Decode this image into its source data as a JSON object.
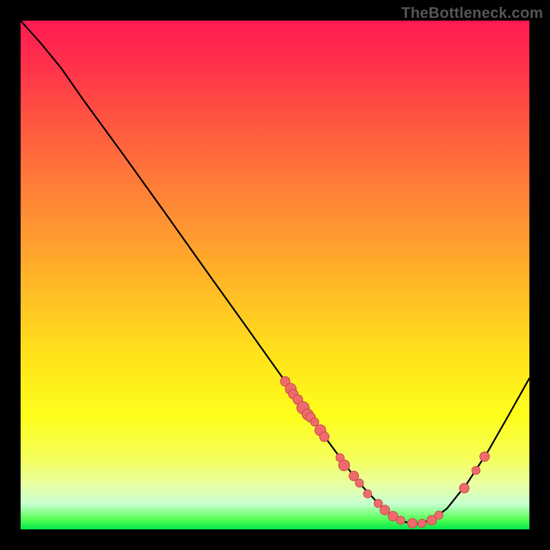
{
  "watermark": "TheBottleneck.com",
  "colors": {
    "point_fill": "#ef6b6b",
    "point_stroke": "#c24848",
    "curve": "#000000"
  },
  "chart_data": {
    "type": "line",
    "title": "",
    "xlabel": "",
    "ylabel": "",
    "xlim": [
      0,
      100
    ],
    "ylim": [
      0,
      100
    ],
    "grid": false,
    "curve": [
      {
        "x": 0.0,
        "y": 100.0
      },
      {
        "x": 4.1,
        "y": 95.4
      },
      {
        "x": 8.1,
        "y": 90.5
      },
      {
        "x": 12.2,
        "y": 84.6
      },
      {
        "x": 20.3,
        "y": 73.5
      },
      {
        "x": 28.4,
        "y": 62.2
      },
      {
        "x": 36.5,
        "y": 50.8
      },
      {
        "x": 44.6,
        "y": 39.5
      },
      {
        "x": 52.7,
        "y": 28.1
      },
      {
        "x": 58.1,
        "y": 20.5
      },
      {
        "x": 62.2,
        "y": 14.9
      },
      {
        "x": 66.2,
        "y": 9.5
      },
      {
        "x": 70.3,
        "y": 5.1
      },
      {
        "x": 73.0,
        "y": 2.7
      },
      {
        "x": 75.7,
        "y": 1.4
      },
      {
        "x": 78.4,
        "y": 1.1
      },
      {
        "x": 81.1,
        "y": 2.0
      },
      {
        "x": 83.8,
        "y": 4.1
      },
      {
        "x": 87.8,
        "y": 9.1
      },
      {
        "x": 91.9,
        "y": 15.4
      },
      {
        "x": 95.9,
        "y": 22.4
      },
      {
        "x": 100.0,
        "y": 29.7
      }
    ],
    "series": [
      {
        "name": "cluster-points",
        "points": [
          {
            "x": 52.0,
            "y": 29.1,
            "r": 7
          },
          {
            "x": 53.1,
            "y": 27.6,
            "r": 8
          },
          {
            "x": 53.6,
            "y": 26.6,
            "r": 7
          },
          {
            "x": 54.5,
            "y": 25.5,
            "r": 7
          },
          {
            "x": 55.5,
            "y": 23.9,
            "r": 9
          },
          {
            "x": 56.4,
            "y": 22.6,
            "r": 8
          },
          {
            "x": 57.0,
            "y": 22.0,
            "r": 7
          },
          {
            "x": 57.8,
            "y": 21.1,
            "r": 6
          },
          {
            "x": 58.9,
            "y": 19.5,
            "r": 8
          },
          {
            "x": 59.7,
            "y": 18.2,
            "r": 7
          },
          {
            "x": 62.8,
            "y": 14.1,
            "r": 6
          },
          {
            "x": 63.6,
            "y": 12.6,
            "r": 8
          },
          {
            "x": 65.5,
            "y": 10.5,
            "r": 7
          },
          {
            "x": 66.6,
            "y": 9.1,
            "r": 6
          },
          {
            "x": 68.2,
            "y": 7.0,
            "r": 6
          },
          {
            "x": 70.3,
            "y": 5.1,
            "r": 6
          },
          {
            "x": 71.6,
            "y": 3.8,
            "r": 7
          },
          {
            "x": 73.2,
            "y": 2.6,
            "r": 7
          },
          {
            "x": 74.7,
            "y": 1.8,
            "r": 6
          },
          {
            "x": 77.0,
            "y": 1.2,
            "r": 7
          },
          {
            "x": 78.9,
            "y": 1.2,
            "r": 6
          },
          {
            "x": 80.8,
            "y": 1.8,
            "r": 7
          },
          {
            "x": 82.2,
            "y": 2.8,
            "r": 6
          },
          {
            "x": 87.2,
            "y": 8.1,
            "r": 7
          },
          {
            "x": 89.5,
            "y": 11.6,
            "r": 6
          },
          {
            "x": 91.2,
            "y": 14.3,
            "r": 7
          }
        ]
      }
    ]
  }
}
